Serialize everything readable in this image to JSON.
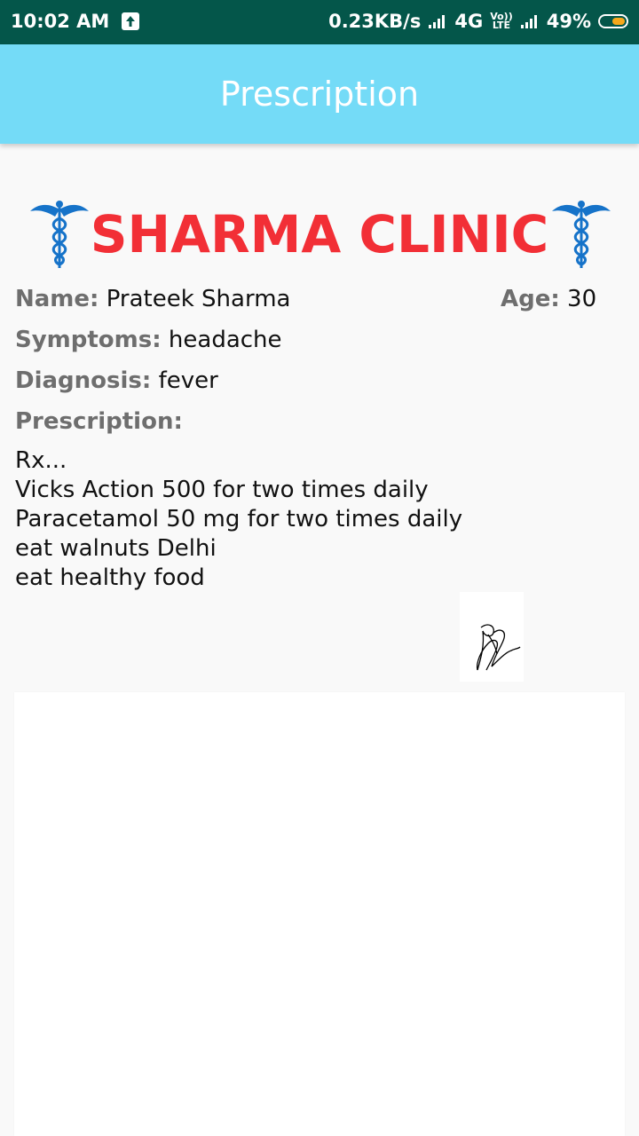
{
  "status_bar": {
    "time": "10:02 AM",
    "speed": "0.23KB/s",
    "network": "4G",
    "volte_top": "Vo))",
    "volte_bottom": "LTE",
    "battery": "49%",
    "icons": [
      "upload-icon",
      "signal-icon",
      "signal-icon",
      "battery-icon"
    ],
    "battery_color": "#f7a81b"
  },
  "app_bar": {
    "title": "Prescription",
    "color": "#74dbf7"
  },
  "clinic": {
    "name": "SHARMA CLINIC",
    "name_color": "#f22f36",
    "logo_icon": "caduceus-icon",
    "logo_color": "#1673c9"
  },
  "patient": {
    "name_label": "Name:",
    "name": "Prateek Sharma",
    "age_label": "Age:",
    "age": "30",
    "symptoms_label": "Symptoms:",
    "symptoms": "headache",
    "diagnosis_label": "Diagnosis:",
    "diagnosis": "fever",
    "prescription_label": "Prescription:",
    "prescription_lines": [
      "Rx...",
      "Vicks Action 500 for two times daily",
      "Paracetamol 50 mg for two times daily",
      "eat walnuts Delhi",
      "eat healthy food"
    ]
  },
  "signature": {
    "icon": "signature-image"
  }
}
